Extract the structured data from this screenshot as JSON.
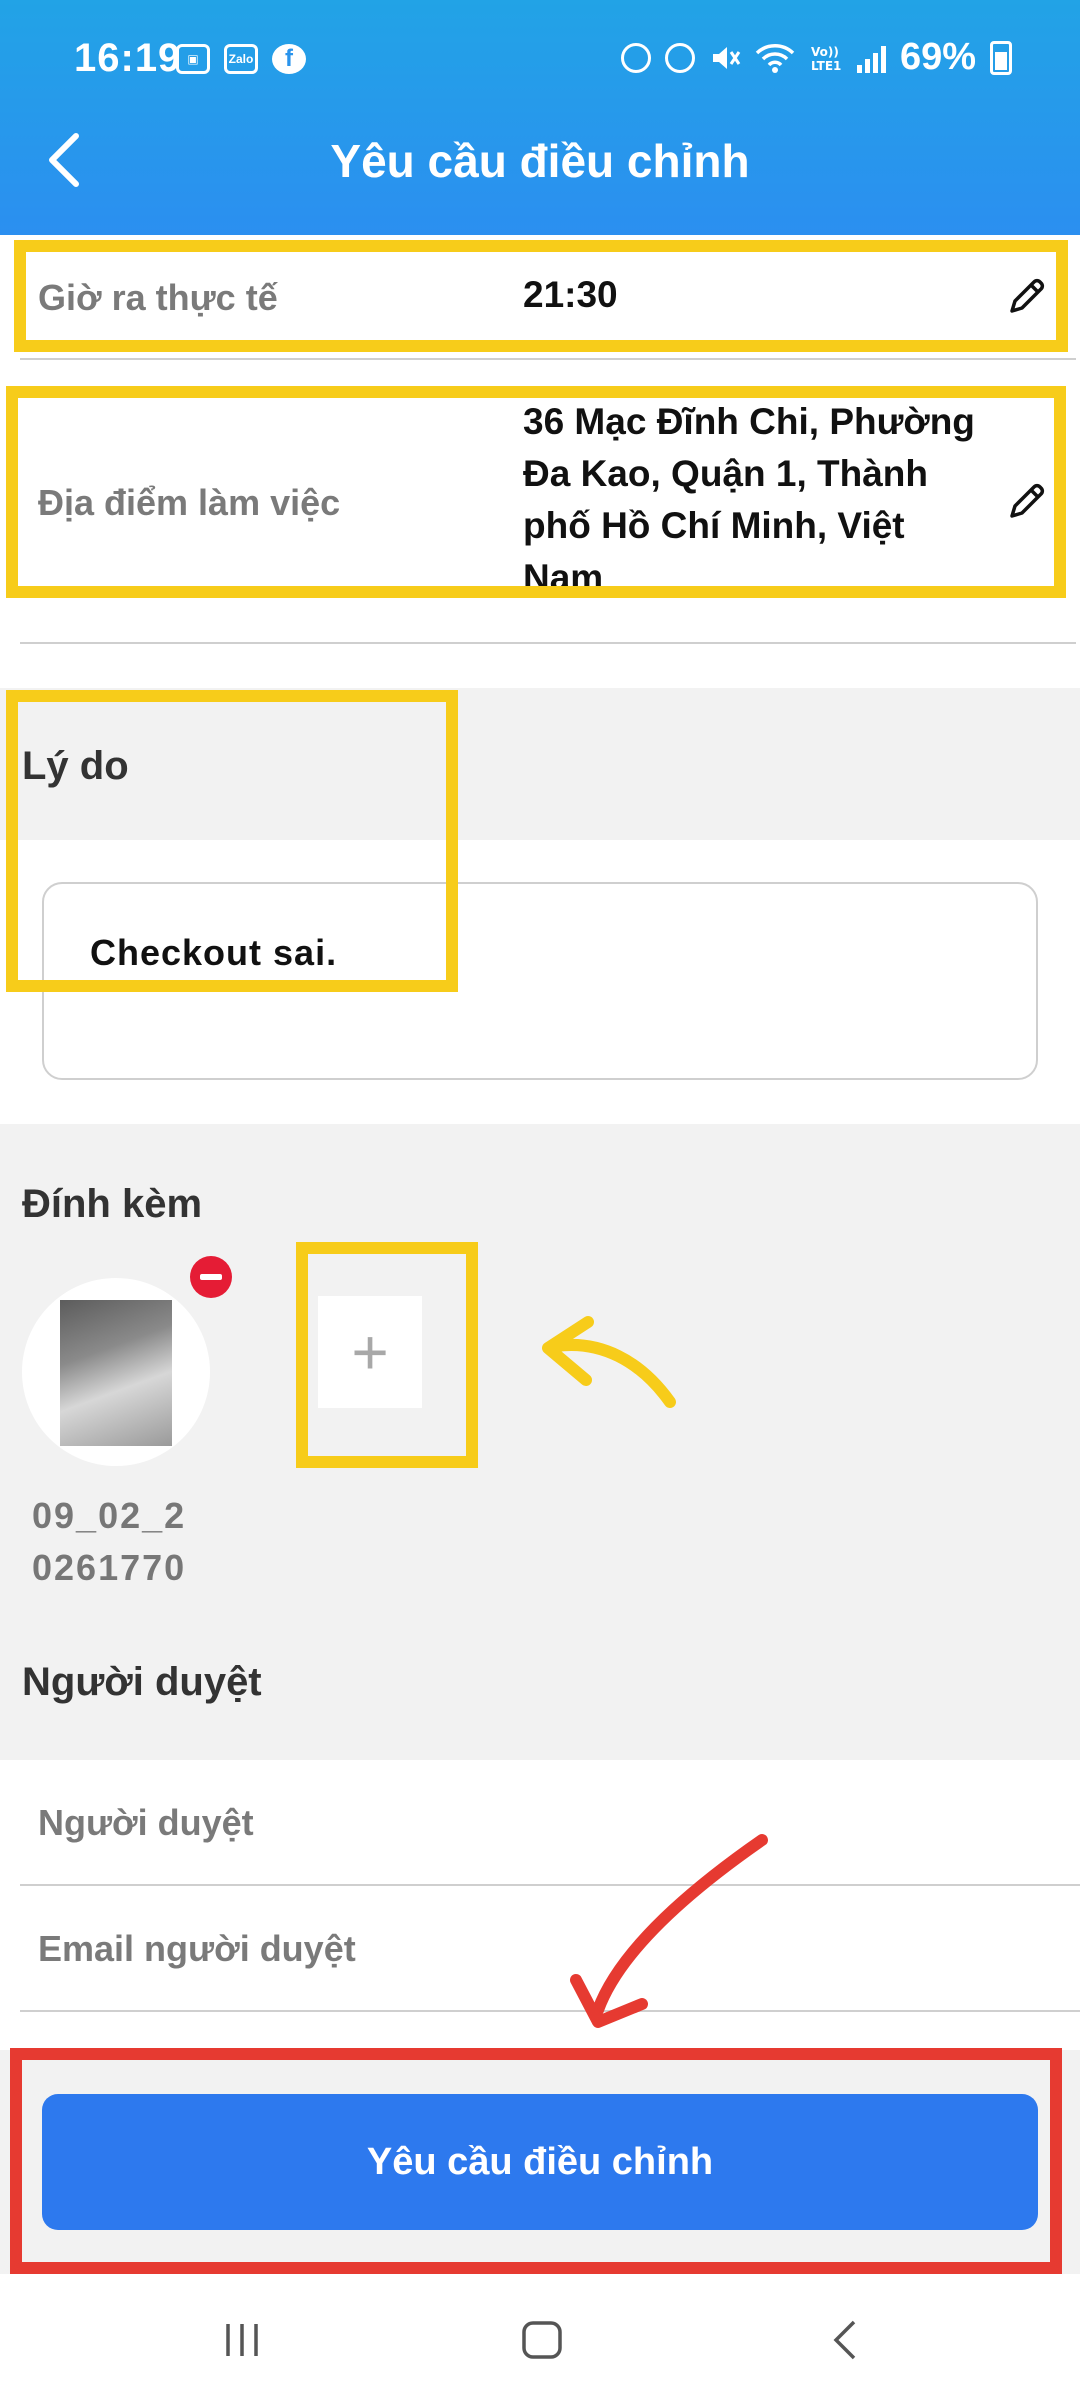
{
  "status_bar": {
    "time": "16:19",
    "left_icons": [
      "gallery-icon",
      "zalo-icon",
      "facebook-icon"
    ],
    "zalo_text": "Zalo",
    "facebook_text": "f",
    "right_icons": [
      "sync-icon",
      "alarm-icon",
      "mute-icon",
      "wifi-icon",
      "volte-icon",
      "signal-icon"
    ],
    "battery": "69%"
  },
  "header": {
    "title": "Yêu cầu điều chỉnh",
    "background": "#2b8ff0"
  },
  "fields": {
    "checkout_time": {
      "label": "Giờ ra thực tế",
      "value": "21:30"
    },
    "work_location": {
      "label": "Địa điểm làm việc",
      "value_lines": [
        "36 Mạc Đĩnh Chi, Phường",
        "Đa Kao, Quận 1, Thành",
        "phố Hồ Chí Minh, Việt",
        "Nam"
      ]
    }
  },
  "reason": {
    "title": "Lý do",
    "value": "Checkout sai."
  },
  "attachments": {
    "title": "Đính kèm",
    "file_name_lines": [
      "09_02_2",
      "0261770"
    ],
    "add_symbol": "+"
  },
  "approver": {
    "title": "Người duyệt",
    "rows": [
      {
        "label": "Người duyệt",
        "value": ""
      },
      {
        "label": "Email người duyệt",
        "value": ""
      }
    ]
  },
  "submit": {
    "label": "Yêu cầu điều chỉnh",
    "color": "#2d79ee"
  },
  "annotation_colors": {
    "yellow": "#f7cc1a",
    "red": "#e63a31"
  },
  "nav_bar": [
    "recents-icon",
    "home-icon",
    "back-icon"
  ]
}
